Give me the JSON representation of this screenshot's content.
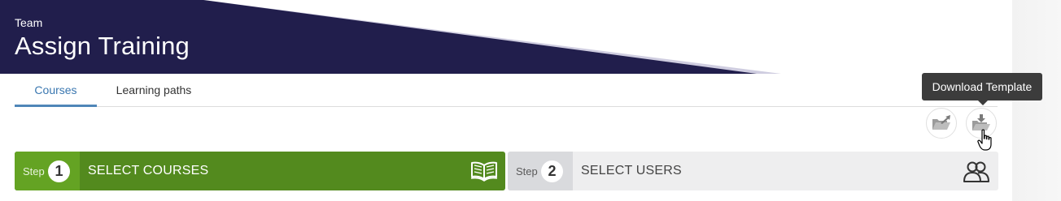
{
  "header": {
    "breadcrumb": "Team",
    "title": "Assign Training",
    "colors": {
      "navy": "#211e4c",
      "lavender": "#cfcde0"
    }
  },
  "tabs": [
    {
      "label": "Courses",
      "active": true
    },
    {
      "label": "Learning paths",
      "active": false
    }
  ],
  "toolbar": {
    "upload_icon": "folder-upload-icon",
    "download_icon": "folder-download-icon",
    "tooltip": "Download Template"
  },
  "steps": [
    {
      "word": "Step",
      "number": "1",
      "label": "SELECT COURSES",
      "icon": "open-book-icon",
      "color": "#538a1e",
      "active": true
    },
    {
      "word": "Step",
      "number": "2",
      "label": "SELECT USERS",
      "icon": "users-icon",
      "color": "#eeeeef",
      "active": false
    }
  ],
  "cursor": "hand-pointer"
}
